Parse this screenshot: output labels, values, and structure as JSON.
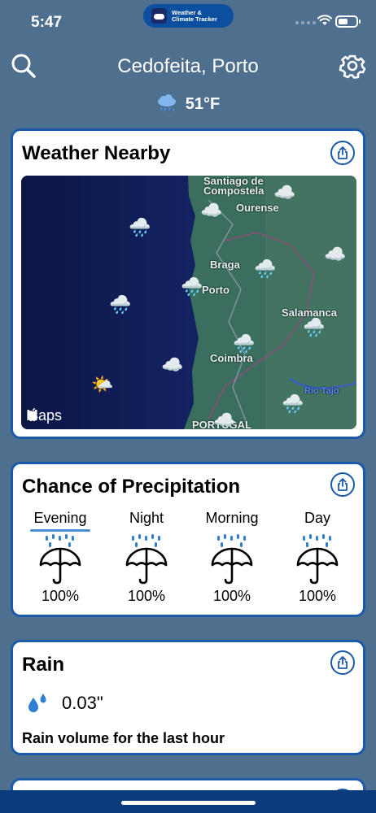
{
  "status_bar": {
    "time": "5:47",
    "app_pill_name_line1": "Weather &",
    "app_pill_name_line2": "Climate Tracker"
  },
  "header": {
    "location": "Cedofeita, Porto",
    "temperature": "51°F",
    "weather_icon": "rain-cloud-icon"
  },
  "nearby": {
    "title": "Weather Nearby",
    "map_labels": [
      "Santiago de",
      "Compostela",
      "Ourense",
      "Braga",
      "Porto",
      "Salamanca",
      "Coimbra",
      "Rio Tajo",
      "PORTUGAL"
    ],
    "maps_brand": "Maps"
  },
  "precipitation": {
    "title": "Chance of Precipitation",
    "periods": [
      {
        "label": "Evening",
        "value": "100%",
        "selected": true
      },
      {
        "label": "Night",
        "value": "100%",
        "selected": false
      },
      {
        "label": "Morning",
        "value": "100%",
        "selected": false
      },
      {
        "label": "Day",
        "value": "100%",
        "selected": false
      }
    ]
  },
  "rain": {
    "title": "Rain",
    "value": "0.03\"",
    "description": "Rain volume for the last hour"
  },
  "colors": {
    "background": "#4f6f8e",
    "card_border": "#1a5aa8",
    "accent": "#4a8fd6"
  }
}
